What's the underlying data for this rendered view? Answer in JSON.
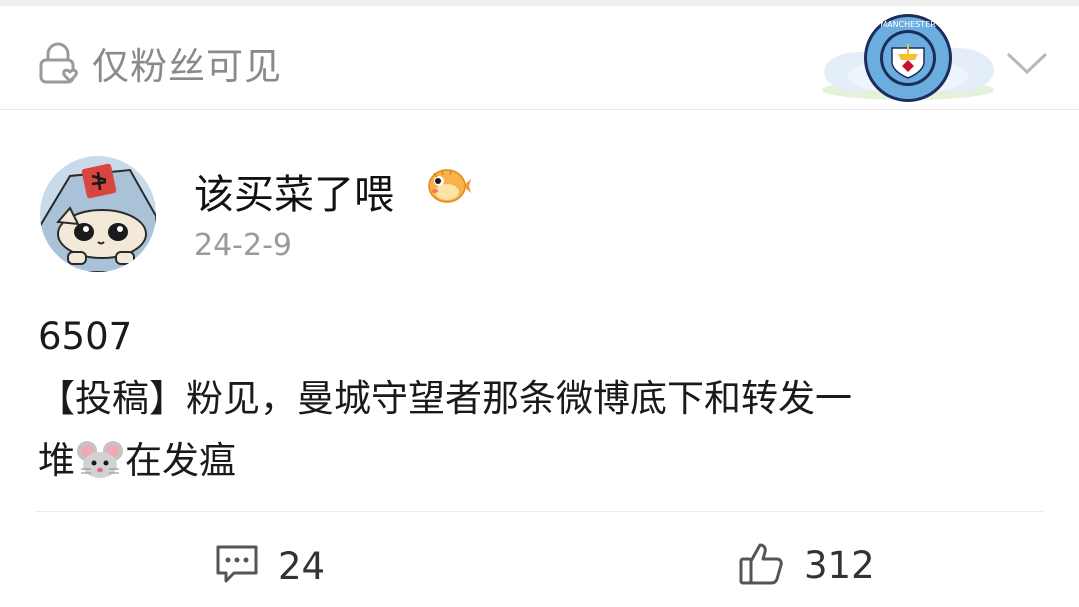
{
  "visibility": {
    "label": "仅粉丝可见"
  },
  "badge": {
    "text": "MANCHESTER"
  },
  "post": {
    "author": "该买菜了喂",
    "date": "24-2-9",
    "body_line1": "6507",
    "body_line2": "【投稿】粉见，曼城守望者那条微博底下和转发一",
    "body_line3_a": "堆",
    "body_line3_b": "在发瘟"
  },
  "actions": {
    "comment_count": "24",
    "like_count": "312"
  },
  "icons": [
    "lock-heart-icon",
    "club-badge-icon",
    "chevron-down-icon",
    "pufferfish-emoji-icon",
    "mouse-emoji-icon",
    "comment-icon",
    "thumbs-up-icon"
  ],
  "colors": {
    "muted_text": "#8a8a8a",
    "badge_blue": "#6caddf",
    "badge_navy": "#1c2c5b"
  }
}
